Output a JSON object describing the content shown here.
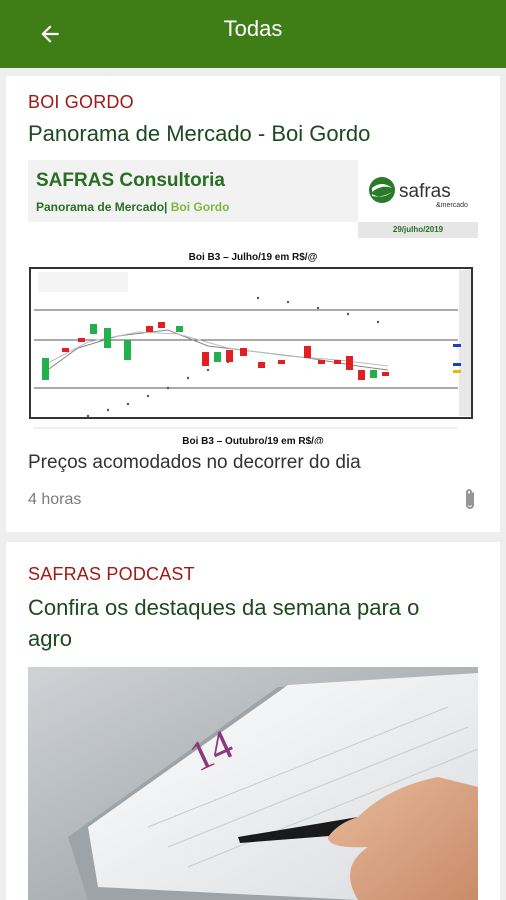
{
  "appbar": {
    "title": "Todas",
    "back_icon": "arrow-left-icon"
  },
  "articles": [
    {
      "category": "BOI GORDO",
      "headline": "Panorama de Mercado - Boi Gordo",
      "subtitle": "Preços acomodados no decorrer do dia",
      "time": "4 horas",
      "attachment_icon": "paperclip-icon",
      "report": {
        "brand_title": "SAFRAS Consultoria",
        "brand_sub_a": "Panorama de Mercado",
        "brand_sub_sep": "|",
        "brand_sub_b": " Boi Gordo",
        "logo_text": "safras",
        "logo_sub": "&mercado",
        "date": "29/julho/2019",
        "chart_title": "Boi B3 – Julho/19 em R$/@",
        "cut_caption": "Boi B3 – Outubro/19 em R$/@"
      }
    },
    {
      "category": "SAFRAS PODCAST",
      "headline": "Confira os destaques da semana para o agro",
      "photo_day": "14"
    }
  ],
  "colors": {
    "appbar": "#3f7d17",
    "category": "#a01915",
    "headline": "#1c4a1e",
    "candle_up": "#22b14c",
    "candle_down": "#e02020"
  }
}
